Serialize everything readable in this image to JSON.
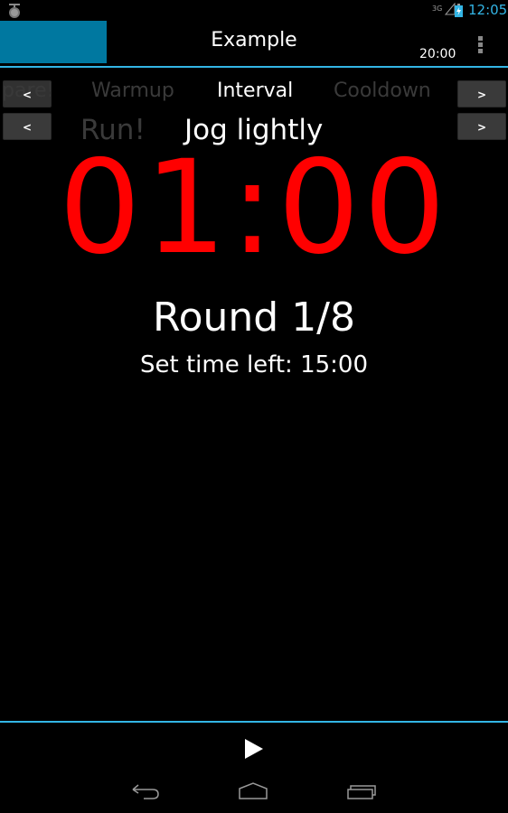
{
  "status_bar": {
    "app_icon": "stopwatch-icon",
    "network": "3G",
    "signal_icon": "signal-icon",
    "battery_icon": "battery-charging-icon",
    "time": "12:05",
    "accent_color": "#33b5e5"
  },
  "action_bar": {
    "title": "Example",
    "total_time": "20:00",
    "menu_icon": "overflow-menu-icon",
    "progress_color": "#0078a0"
  },
  "phase_row": {
    "prev_label": "<",
    "next_label": ">",
    "previous_phase_partial": "pare!",
    "phases": [
      "Warmup",
      "Interval",
      "Cooldown"
    ],
    "current_phase": "Interval"
  },
  "step_row": {
    "prev_label": "<",
    "next_label": ">",
    "previous_step": "Run!",
    "current_step": "Jog lightly"
  },
  "timer": {
    "time": "01:00",
    "color": "#ff0000"
  },
  "round": {
    "text": "Round 1/8"
  },
  "set_time_left": {
    "text": "Set time left: 15:00"
  },
  "controls": {
    "play_icon": "play-icon"
  },
  "nav_bar": {
    "back_icon": "back-icon",
    "home_icon": "home-icon",
    "recents_icon": "recent-apps-icon"
  }
}
